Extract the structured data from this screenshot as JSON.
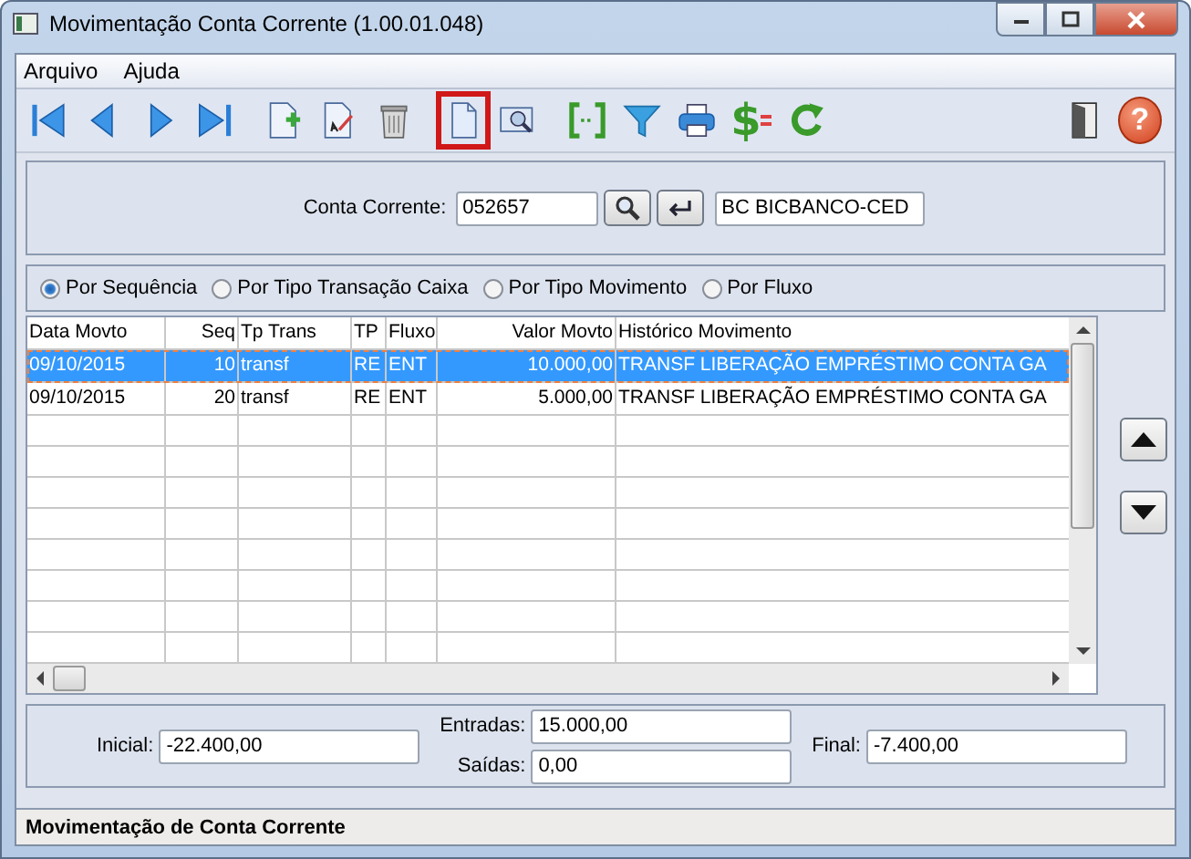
{
  "window": {
    "title": "Movimentação Conta Corrente (1.00.01.048)"
  },
  "menu": [
    "Arquivo",
    "Ajuda"
  ],
  "toolbar": [
    {
      "kind": "first",
      "highlighted": false
    },
    {
      "kind": "prev",
      "highlighted": false
    },
    {
      "kind": "next",
      "highlighted": false
    },
    {
      "kind": "last",
      "highlighted": false
    },
    {
      "kind": "sep"
    },
    {
      "kind": "new",
      "highlighted": false
    },
    {
      "kind": "edit",
      "highlighted": false
    },
    {
      "kind": "delete",
      "highlighted": false
    },
    {
      "kind": "sep"
    },
    {
      "kind": "document",
      "highlighted": true
    },
    {
      "kind": "preview",
      "highlighted": false
    },
    {
      "kind": "sep"
    },
    {
      "kind": "brackets",
      "highlighted": false
    },
    {
      "kind": "filter",
      "highlighted": false
    },
    {
      "kind": "print",
      "highlighted": false
    },
    {
      "kind": "money",
      "highlighted": false,
      "glyph": "$"
    },
    {
      "kind": "refresh",
      "highlighted": false
    },
    {
      "kind": "spacer"
    },
    {
      "kind": "exit",
      "highlighted": false
    },
    {
      "kind": "help",
      "highlighted": false,
      "glyph": "?"
    }
  ],
  "account": {
    "label": "Conta Corrente:",
    "value": "052657",
    "name": "BC BICBANCO-CED"
  },
  "order_options": [
    {
      "label": "Por Sequência",
      "selected": true
    },
    {
      "label": "Por Tipo Transação Caixa",
      "selected": false
    },
    {
      "label": "Por Tipo Movimento",
      "selected": false
    },
    {
      "label": "Por Fluxo",
      "selected": false
    }
  ],
  "table": {
    "columns": [
      "Data Movto",
      "Seq",
      "Tp Trans",
      "TP",
      "Fluxo",
      "Valor Movto",
      "Histórico Movimento"
    ],
    "rows": [
      {
        "cells": [
          "09/10/2015",
          "10",
          "transf",
          "RE",
          "ENT",
          "10.000,00",
          "TRANSF LIBERAÇÃO EMPRÉSTIMO CONTA GA"
        ],
        "selected": true
      },
      {
        "cells": [
          "09/10/2015",
          "20",
          "transf",
          "RE",
          "ENT",
          "5.000,00",
          "TRANSF LIBERAÇÃO EMPRÉSTIMO CONTA GA"
        ],
        "selected": false
      }
    ]
  },
  "totals": {
    "initial": {
      "label": "Inicial:",
      "value": "-22.400,00"
    },
    "inflows": {
      "label": "Entradas:",
      "value": "15.000,00"
    },
    "outflows": {
      "label": "Saídas:",
      "value": "0,00"
    },
    "final": {
      "label": "Final:",
      "value": "-7.400,00"
    }
  },
  "status_bar": "Movimentação de Conta Corrente"
}
